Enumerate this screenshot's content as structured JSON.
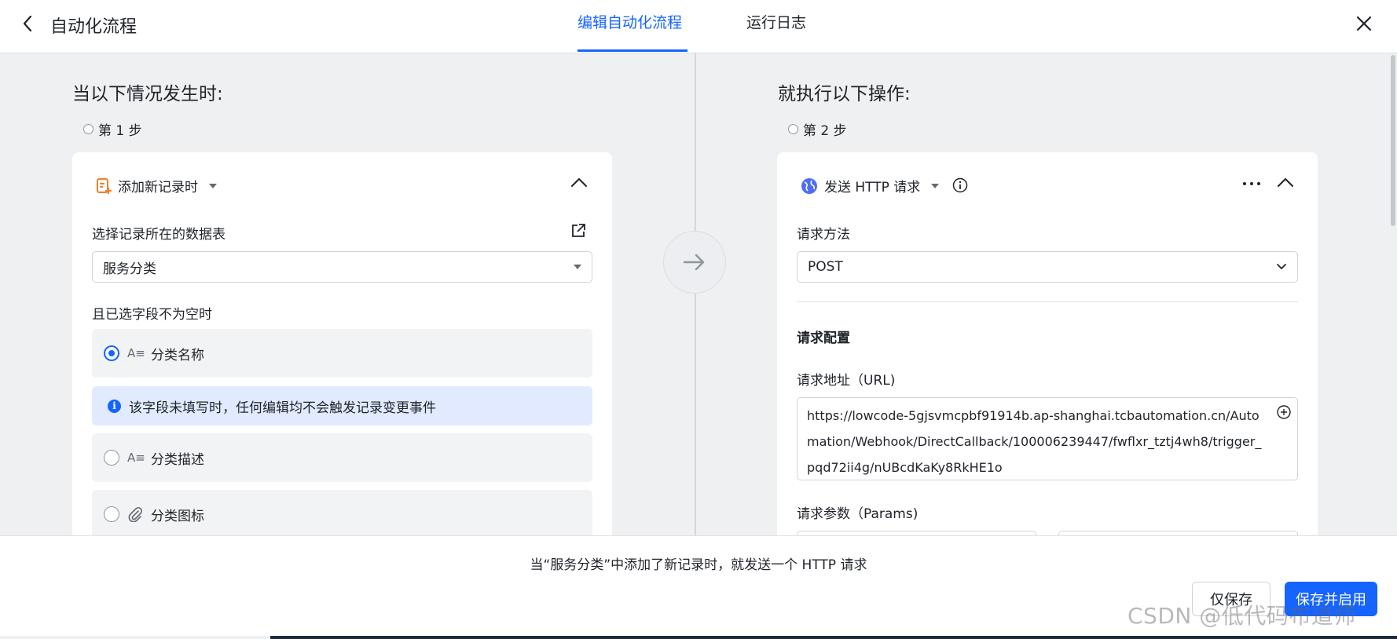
{
  "header": {
    "title": "自动化流程",
    "tabs": [
      {
        "label": "编辑自动化流程",
        "active": true
      },
      {
        "label": "运行日志",
        "active": false
      }
    ]
  },
  "left": {
    "section_title": "当以下情况发生时:",
    "step_label": "第 1 步",
    "trigger": {
      "label": "添加新记录时",
      "icon": "add-record-icon"
    },
    "table_label": "选择记录所在的数据表",
    "table_value": "服务分类",
    "field_section_label": "且已选字段不为空时",
    "fields": [
      {
        "label": "分类名称",
        "type_icon": "text-field-icon",
        "checked": true
      },
      {
        "label": "分类描述",
        "type_icon": "text-field-icon",
        "checked": false
      },
      {
        "label": "分类图标",
        "type_icon": "attachment-icon",
        "checked": false
      }
    ],
    "notice": "该字段未填写时，任何编辑均不会触发记录变更事件"
  },
  "right": {
    "section_title": "就执行以下操作:",
    "step_label": "第 2 步",
    "action": {
      "label": "发送 HTTP 请求",
      "icon": "globe-icon"
    },
    "method_label": "请求方法",
    "method_value": "POST",
    "config_title": "请求配置",
    "url_label": "请求地址（URL)",
    "url_value": "https://lowcode-5gjsvmcpbf91914b.ap-shanghai.tcbautomation.cn/Automation/Webhook/DirectCallback/100006239447/fwflxr_tztj4wh8/trigger_pqd72ii4g/nUBcdKaKy8RkHE1o",
    "params_label": "请求参数（Params)"
  },
  "footer": {
    "summary": "当“服务分类”中添加了新记录时，就发送一个 HTTP 请求",
    "save_only_label": "仅保存",
    "save_enable_label": "保存并启用",
    "watermark": "CSDN @低代码布道师"
  },
  "colors": {
    "accent": "#1664ff",
    "trigger_icon": "#f5802a",
    "notice_bg": "#e1eaff"
  }
}
